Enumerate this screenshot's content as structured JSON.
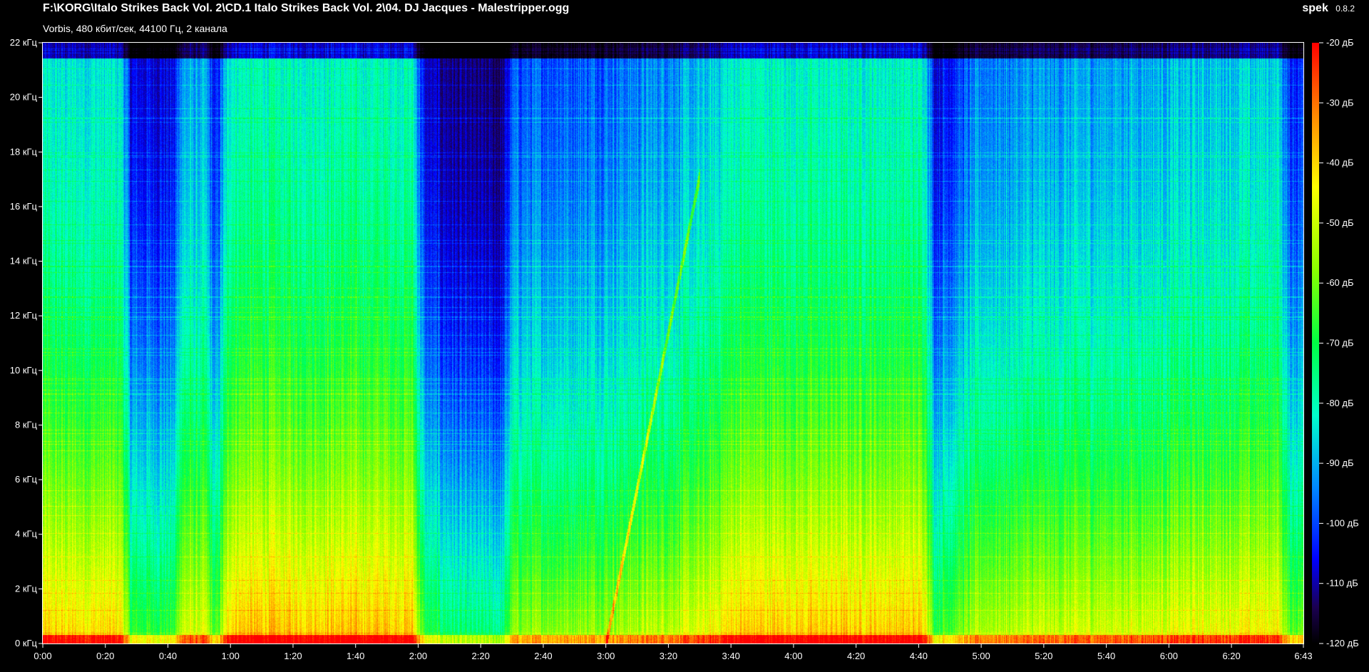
{
  "header": {
    "file_path": "F:\\KORG\\Italo Strikes Back Vol. 2\\CD.1 Italo Strikes Back Vol. 2\\04. DJ Jacques - Malestripper.ogg",
    "stream_info": "Vorbis, 480 кбит/сек, 44100 Гц, 2 канала",
    "app_name": "spek",
    "app_version": "0.8.2"
  },
  "axes": {
    "freq_labels": [
      "0 кГц",
      "2 кГц",
      "4 кГц",
      "6 кГц",
      "8 кГц",
      "10 кГц",
      "12 кГц",
      "14 кГц",
      "16 кГц",
      "18 кГц",
      "20 кГц",
      "22 кГц"
    ],
    "time_labels": [
      "0:00",
      "0:20",
      "0:40",
      "1:00",
      "1:20",
      "1:40",
      "2:00",
      "2:20",
      "2:40",
      "3:00",
      "3:20",
      "3:40",
      "4:00",
      "4:20",
      "4:40",
      "5:00",
      "5:20",
      "5:40",
      "6:00",
      "6:20",
      "6:43"
    ],
    "time_seconds": [
      0,
      20,
      40,
      60,
      80,
      100,
      120,
      140,
      160,
      180,
      200,
      220,
      240,
      260,
      280,
      300,
      320,
      340,
      360,
      380,
      403
    ],
    "db_labels": [
      "-20 дБ",
      "-30 дБ",
      "-40 дБ",
      "-50 дБ",
      "-60 дБ",
      "-70 дБ",
      "-80 дБ",
      "-90 дБ",
      "-100 дБ",
      "-110 дБ",
      "-120 дБ"
    ]
  },
  "chart_data": {
    "type": "heatmap",
    "x_range_seconds": [
      0,
      403
    ],
    "y_range_khz": [
      0,
      22
    ],
    "z_range_db": [
      -120,
      -20
    ],
    "colormap": [
      "#000000",
      "#1a0050",
      "#0000ff",
      "#0088ff",
      "#00ffcc",
      "#00ff44",
      "#88ff00",
      "#ffff00",
      "#ff8800",
      "#ff0000"
    ],
    "colorbar_ticks_db": [
      -20,
      -30,
      -40,
      -50,
      -60,
      -70,
      -80,
      -90,
      -100,
      -110,
      -120
    ]
  }
}
